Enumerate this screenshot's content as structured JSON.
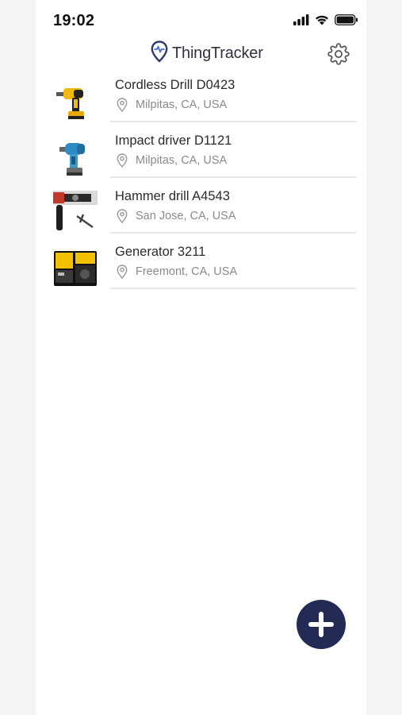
{
  "status_bar": {
    "time": "19:02",
    "icons": [
      "cellular-signal-icon",
      "wifi-icon",
      "battery-icon"
    ]
  },
  "header": {
    "logo_icon": "location-pulse-icon",
    "title": "ThingTracker",
    "settings_icon": "gear-icon"
  },
  "items": [
    {
      "name": "Cordless Drill D0423",
      "location": "Milpitas, CA, USA",
      "thumbnail": "cordless-drill-image"
    },
    {
      "name": "Impact driver D1121",
      "location": "Milpitas, CA, USA",
      "thumbnail": "impact-driver-image"
    },
    {
      "name": "Hammer drill A4543",
      "location": "San Jose, CA, USA",
      "thumbnail": "hammer-drill-image"
    },
    {
      "name": "Generator 3211",
      "location": "Freemont, CA, USA",
      "thumbnail": "generator-image"
    }
  ],
  "fab": {
    "icon": "plus-icon"
  },
  "colors": {
    "accent": "#232b55",
    "text_primary": "#2b2b2b",
    "text_secondary": "#8a8a8a",
    "divider": "#e6e6e6"
  }
}
